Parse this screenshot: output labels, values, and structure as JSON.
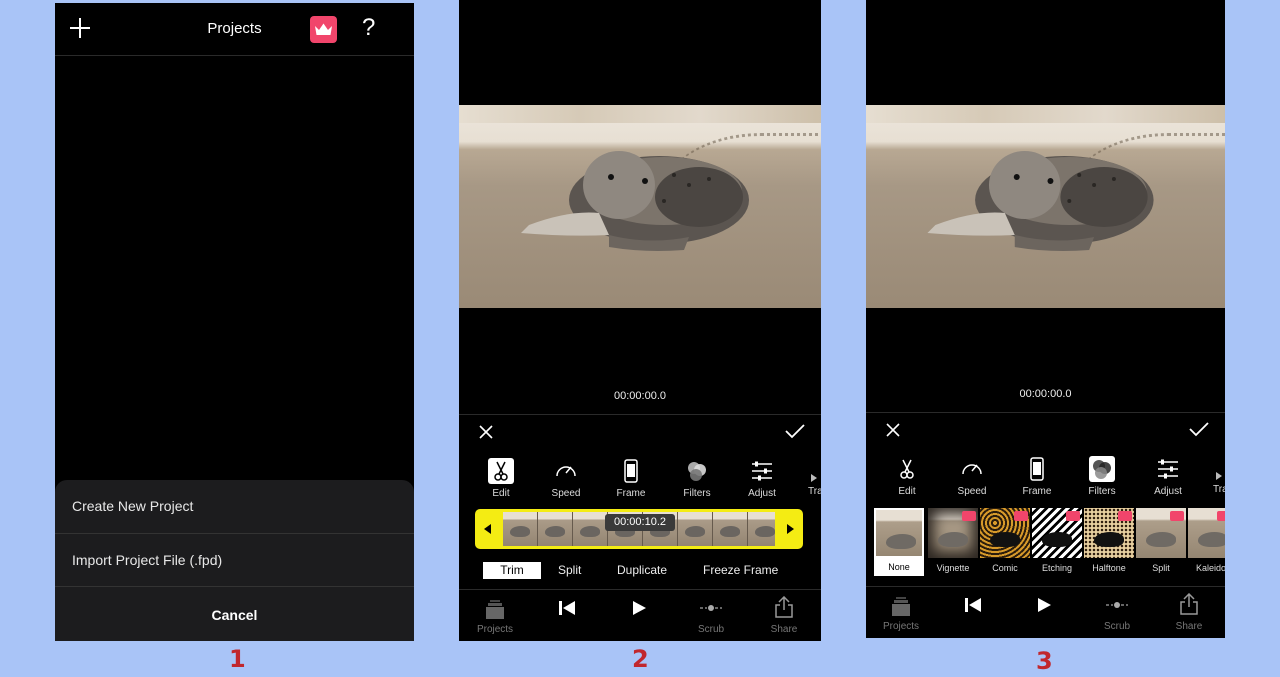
{
  "screen1": {
    "title": "Projects",
    "help_label": "?",
    "sheet": {
      "create_label": "Create New Project",
      "import_label": "Import Project File (.fpd)",
      "cancel_label": "Cancel"
    }
  },
  "screen2": {
    "timecode": "00:00:00.0",
    "tools": [
      "Edit",
      "Speed",
      "Frame",
      "Filters",
      "Adjust"
    ],
    "trailing_tool": "Tra",
    "selected_tool": "Edit",
    "timeline_time": "00:00:10.2",
    "edit_tabs": [
      "Trim",
      "Split",
      "Duplicate",
      "Freeze Frame"
    ],
    "active_edit_tab": "Trim",
    "bottom_bar": [
      "Projects",
      "Scrub",
      "Share"
    ]
  },
  "screen3": {
    "timecode": "00:00:00.0",
    "tools": [
      "Edit",
      "Speed",
      "Frame",
      "Filters",
      "Adjust"
    ],
    "trailing_tool": "Tra",
    "selected_tool": "Filters",
    "filters": [
      "None",
      "Vignette",
      "Comic",
      "Etching",
      "Halftone",
      "Split",
      "Kaleido"
    ],
    "selected_filter": "None",
    "bottom_bar": [
      "Projects",
      "Scrub",
      "Share"
    ]
  },
  "step_labels": [
    "1",
    "2",
    "3"
  ],
  "colors": {
    "background": "#a9c4f7",
    "premium_badge": "#f1456b",
    "timeline": "#f4ec13",
    "step_label": "#c1272d"
  }
}
